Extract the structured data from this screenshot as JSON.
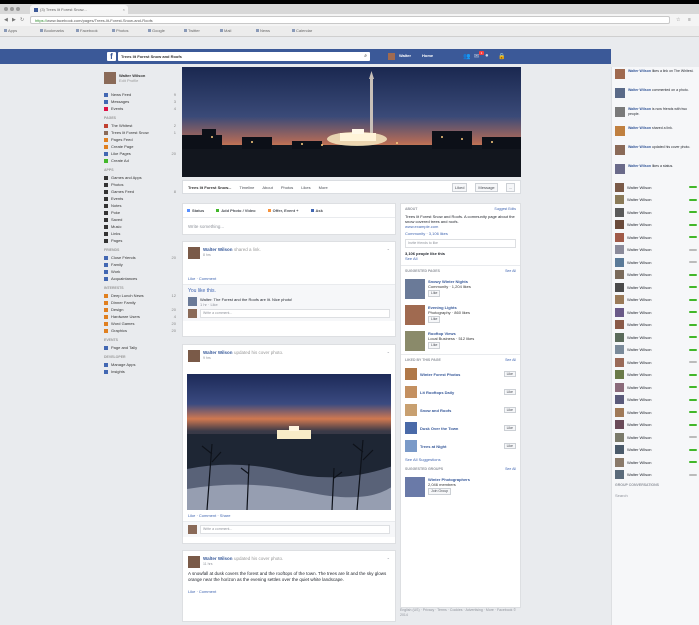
{
  "browser": {
    "tab_title": "(3) Trees lit Forest Snow...",
    "tab_close": "×",
    "url_secure": "https://",
    "url_rest": "www.facebook.com/pages/Trees-lit-Forest-Snow-and-Roofs",
    "bookmarks": [
      "Apps",
      "Bookmarks",
      "Facebook",
      "Photos",
      "Google",
      "Twitter",
      "Mail",
      "News",
      "Calendar"
    ]
  },
  "fb": {
    "logo": "f",
    "search_value": "Trees lit Forest Snow and Roofs",
    "user_short": "Walter",
    "home_label": "Home"
  },
  "left": {
    "name": "Walter Wilson",
    "edit": "Edit Profile",
    "items": [
      {
        "label": "News Feed",
        "count": "9",
        "color": "#4267b2"
      },
      {
        "label": "Messages",
        "count": "3",
        "color": "#4267b2"
      },
      {
        "label": "Events",
        "count": "4",
        "color": "#d14"
      }
    ],
    "groups_h": "PAGES",
    "groups": [
      {
        "label": "The Whitest",
        "count": "2",
        "color": "#c04030"
      },
      {
        "label": "Trees lit Forest Snow",
        "count": "1",
        "color": "#8a6a58"
      },
      {
        "label": "Pages Feed",
        "count": "",
        "color": "#e08020"
      },
      {
        "label": "Create Page",
        "count": "",
        "color": "#e08020"
      },
      {
        "label": "Like Pages",
        "count": "20",
        "color": "#4267b2"
      },
      {
        "label": "Create Ad",
        "count": "",
        "color": "#42b72a"
      }
    ],
    "apps_h": "APPS",
    "apps": [
      {
        "label": "Games and Apps",
        "count": "",
        "color": "#333"
      },
      {
        "label": "Photos",
        "count": "",
        "color": "#333"
      },
      {
        "label": "Games Feed",
        "count": "8",
        "color": "#333"
      },
      {
        "label": "Events",
        "count": "",
        "color": "#333"
      },
      {
        "label": "Notes",
        "count": "",
        "color": "#333"
      },
      {
        "label": "Poke",
        "count": "",
        "color": "#333"
      },
      {
        "label": "Saved",
        "count": "",
        "color": "#333"
      },
      {
        "label": "Music",
        "count": "",
        "color": "#333"
      },
      {
        "label": "Links",
        "count": "",
        "color": "#333"
      },
      {
        "label": "Pages",
        "count": "",
        "color": "#333"
      }
    ],
    "friends_h": "FRIENDS",
    "friends": [
      {
        "label": "Close Friends",
        "count": "20",
        "color": "#4267b2"
      },
      {
        "label": "Family",
        "count": "",
        "color": "#4267b2"
      },
      {
        "label": "Work",
        "count": "",
        "color": "#4267b2"
      },
      {
        "label": "Acquaintances",
        "count": "",
        "color": "#4267b2"
      }
    ],
    "interests_h": "INTERESTS",
    "interests": [
      {
        "label": "Deep Lunch News",
        "count": "12",
        "color": "#e08020"
      },
      {
        "label": "Dinner Family",
        "count": "",
        "color": "#e08020"
      },
      {
        "label": "Design",
        "count": "20",
        "color": "#e08020"
      },
      {
        "label": "Hardware Users",
        "count": "4",
        "color": "#e08020"
      },
      {
        "label": "Word Games",
        "count": "20",
        "color": "#e08020"
      },
      {
        "label": "Graphics",
        "count": "20",
        "color": "#e08020"
      }
    ],
    "events_h": "EVENTS",
    "events": [
      {
        "label": "Page and Tally",
        "count": "",
        "color": "#4267b2"
      }
    ],
    "more_h": "DEVELOPER",
    "more": [
      {
        "label": "Manage Apps",
        "count": "",
        "color": "#4267b2"
      },
      {
        "label": "Insights",
        "count": "",
        "color": "#4267b2"
      }
    ]
  },
  "page": {
    "name": "Trees lit Forest Snow...",
    "nav": [
      "Timeline",
      "About",
      "Photos",
      "Likes",
      "More"
    ],
    "liked_btn": "Liked",
    "message_btn": "Message",
    "more_btn": "..."
  },
  "composer": {
    "tabs": [
      "Status",
      "Add Photo / Video",
      "Offer, Event +",
      "Ask"
    ],
    "placeholder": "Write something..."
  },
  "posts": [
    {
      "author": "Walter Wilson",
      "action": "shared a link.",
      "time": "8 hrs",
      "actions": "Like · Comment",
      "likes": "You like this.",
      "comment": "Walter: The Forest and the Roofs are lit. Nice photo!",
      "comment_time": "1 hr · Like",
      "input_placeholder": "Write a comment..."
    },
    {
      "author": "Walter Wilson",
      "action": "updated his cover photo.",
      "time": "9 hrs",
      "actions": "Like · Comment · Share",
      "input_placeholder": "Write a comment..."
    },
    {
      "author": "Walter Wilson",
      "action": "updated his cover photo.",
      "time": "11 hrs",
      "text": "A snowfall at dusk covers the forest and the rooftops of the town. The trees are lit and the sky glows orange near the horizon as the evening settles over the quiet white landscape.",
      "actions": "Like · Comment"
    }
  ],
  "right": {
    "about_h": "ABOUT",
    "about_lnk": "Suggest Edits",
    "about_txt": "Trees lit Forest Snow and Roofs. A community page about the snow covered trees and roofs.",
    "about_url": "www.example.com",
    "about_line2": "Community · 3,106 likes",
    "invite_placeholder": "Invite friends to like",
    "like_count": "3,106 people like this",
    "see_all": "See All",
    "suggest_h": "SUGGESTED PAGES",
    "suggestions": [
      {
        "title": "Snowy Winter Nights",
        "meta": "Community · 1,204 likes",
        "btn": "Like",
        "color": "#6a7a98"
      },
      {
        "title": "Evening Lights",
        "meta": "Photography · 860 likes",
        "btn": "Like",
        "color": "#a06a50"
      },
      {
        "title": "Rooftop Views",
        "meta": "Local Business · 512 likes",
        "btn": "Like",
        "color": "#8a8a6a"
      }
    ],
    "liked_h": "LIKED BY THIS PAGE",
    "liked_lnk": "See All",
    "pages": [
      {
        "name": "Winter Forest Photos",
        "btn": "Like",
        "color": "#b07848"
      },
      {
        "name": "Lit Rooftops Daily",
        "btn": "Like",
        "color": "#c49060"
      },
      {
        "name": "Snow and Roofs",
        "btn": "Like",
        "color": "#c8a070"
      },
      {
        "name": "Dusk Over the Town",
        "btn": "Like",
        "color": "#4a6aa8"
      },
      {
        "name": "Trees at Night",
        "btn": "Like",
        "color": "#7a9ac8"
      }
    ],
    "more_lnk": "See All Suggestions",
    "groups_h": "SUGGESTED GROUPS",
    "groups_lnk": "See All",
    "group": {
      "title": "Winter Photographers",
      "meta": "2,046 members",
      "btn": "Join Group"
    },
    "footer": "English (US) · Privacy · Terms · Cookies · Advertising · More · Facebook © 2014"
  },
  "ticker": {
    "stories": [
      {
        "who": "Walter Wilson",
        "what": "likes a link on The Whitest.",
        "color": "#a06a50"
      },
      {
        "who": "Walter Wilson",
        "what": "commented on a photo.",
        "color": "#5a6a88"
      },
      {
        "who": "Walter Wilson",
        "what": "is now friends with two people.",
        "color": "#7a7a7a"
      },
      {
        "who": "Walter Wilson",
        "what": "shared a link.",
        "color": "#c08040"
      },
      {
        "who": "Walter Wilson",
        "what": "updated his cover photo.",
        "color": "#8a6a58"
      },
      {
        "who": "Walter Wilson",
        "what": "likes a status.",
        "color": "#6a6a8a"
      }
    ],
    "chat": [
      {
        "name": "Walter Wilson",
        "online": true,
        "color": "#7a5a48"
      },
      {
        "name": "Walter Wilson",
        "online": true,
        "color": "#8a7a58"
      },
      {
        "name": "Walter Wilson",
        "online": true,
        "color": "#5a5a5a"
      },
      {
        "name": "Walter Wilson",
        "online": true,
        "color": "#6a4a3a"
      },
      {
        "name": "Walter Wilson",
        "online": true,
        "color": "#a05a48"
      },
      {
        "name": "Walter Wilson",
        "online": false,
        "color": "#8a8a9a"
      },
      {
        "name": "Walter Wilson",
        "online": false,
        "color": "#5a7a98"
      },
      {
        "name": "Walter Wilson",
        "online": true,
        "color": "#7a6a5a"
      },
      {
        "name": "Walter Wilson",
        "online": true,
        "color": "#4a4a4a"
      },
      {
        "name": "Walter Wilson",
        "online": true,
        "color": "#9a7a58"
      },
      {
        "name": "Walter Wilson",
        "online": true,
        "color": "#6a5a88"
      },
      {
        "name": "Walter Wilson",
        "online": true,
        "color": "#8a5a48"
      },
      {
        "name": "Walter Wilson",
        "online": true,
        "color": "#5a6a5a"
      },
      {
        "name": "Walter Wilson",
        "online": true,
        "color": "#7a8a9a"
      },
      {
        "name": "Walter Wilson",
        "online": false,
        "color": "#9a6a58"
      },
      {
        "name": "Walter Wilson",
        "online": true,
        "color": "#6a7a48"
      },
      {
        "name": "Walter Wilson",
        "online": true,
        "color": "#8a6a7a"
      },
      {
        "name": "Walter Wilson",
        "online": true,
        "color": "#5a5a7a"
      },
      {
        "name": "Walter Wilson",
        "online": true,
        "color": "#a07a58"
      },
      {
        "name": "Walter Wilson",
        "online": true,
        "color": "#6a4a58"
      },
      {
        "name": "Walter Wilson",
        "online": false,
        "color": "#7a7a6a"
      },
      {
        "name": "Walter Wilson",
        "online": true,
        "color": "#4a5a6a"
      },
      {
        "name": "Walter Wilson",
        "online": true,
        "color": "#8a7a6a"
      },
      {
        "name": "Walter Wilson",
        "online": false,
        "color": "#5a6a7a"
      }
    ],
    "groups_h": "GROUP CONVERSATIONS",
    "search": "Search"
  }
}
